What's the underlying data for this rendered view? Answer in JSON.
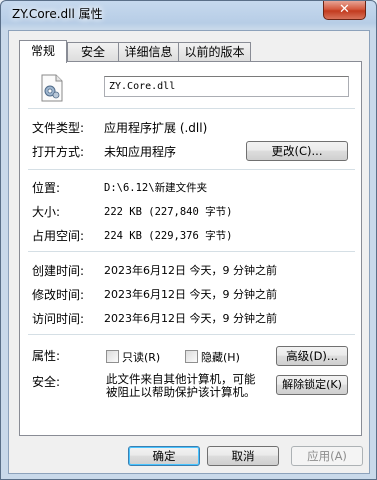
{
  "window": {
    "title": "ZY.Core.dll 属性",
    "close_label": "✕"
  },
  "tabs": [
    {
      "label": "常规",
      "active": true
    },
    {
      "label": "安全",
      "active": false
    },
    {
      "label": "详细信息",
      "active": false
    },
    {
      "label": "以前的版本",
      "active": false
    }
  ],
  "general": {
    "file_name": "ZY.Core.dll",
    "file_type_label": "文件类型:",
    "file_type_value": "应用程序扩展 (.dll)",
    "open_with_label": "打开方式:",
    "open_with_value": "未知应用程序",
    "change_button": "更改(C)...",
    "location_label": "位置:",
    "location_value": "D:\\6.12\\新建文件夹",
    "size_label": "大小:",
    "size_value": "222 KB (227,840 字节)",
    "size_on_disk_label": "占用空间:",
    "size_on_disk_value": "224 KB (229,376 字节)",
    "created_label": "创建时间:",
    "created_value": "2023年6月12日 今天，9 分钟之前",
    "modified_label": "修改时间:",
    "modified_value": "2023年6月12日 今天，9 分钟之前",
    "accessed_label": "访问时间:",
    "accessed_value": "2023年6月12日 今天，9 分钟之前",
    "attributes_label": "属性:",
    "readonly_label": "只读(R)",
    "hidden_label": "隐藏(H)",
    "advanced_button": "高级(D)...",
    "security_label": "安全:",
    "security_text": "此文件来自其他计算机，可能被阻止以帮助保护该计算机。",
    "unblock_button": "解除锁定(K)"
  },
  "footer": {
    "ok_button": "确定",
    "cancel_button": "取消",
    "apply_button": "应用(A)"
  }
}
